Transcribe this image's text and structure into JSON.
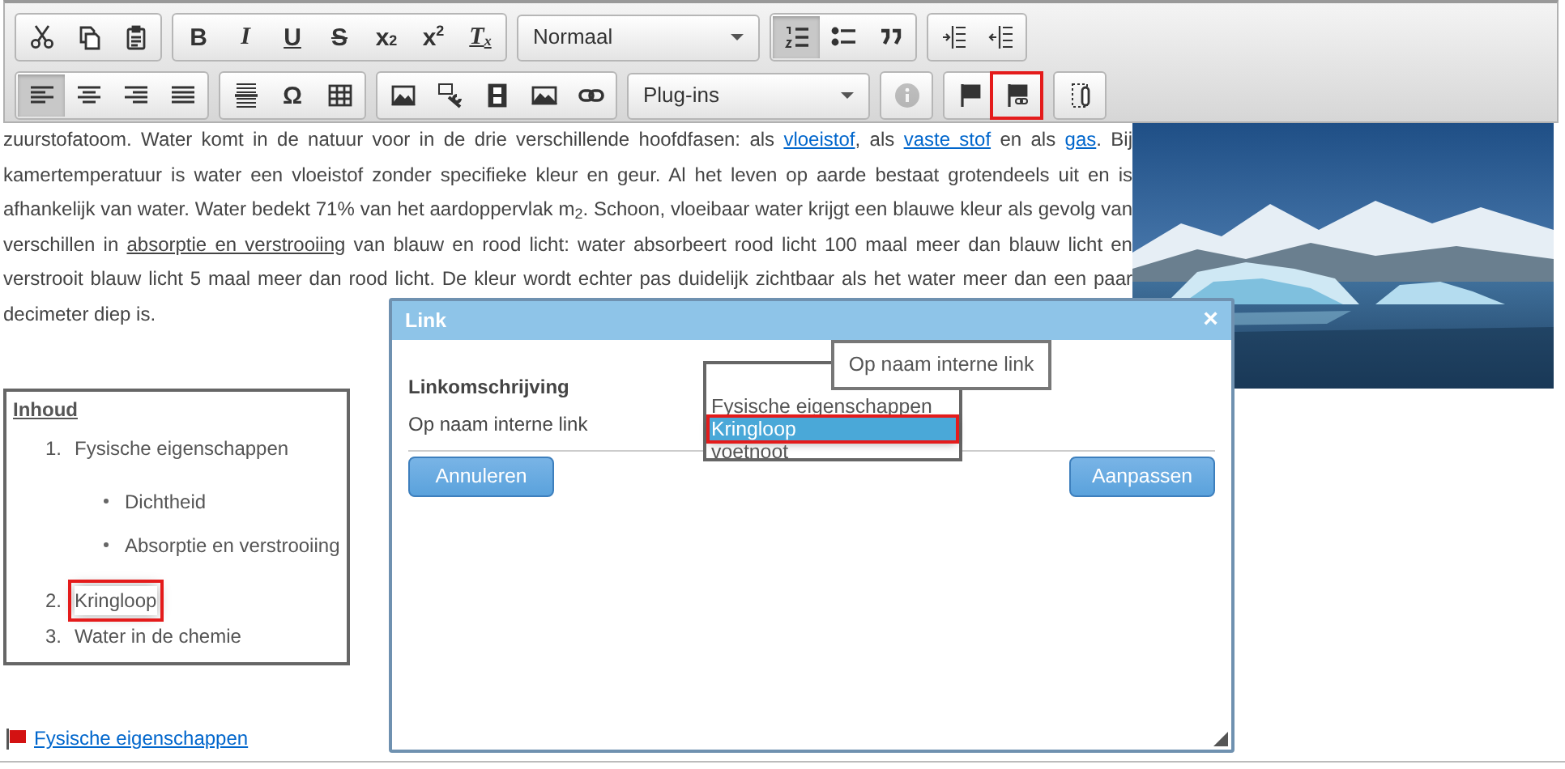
{
  "toolbar": {
    "rows": [
      [
        {
          "buttons": [
            {
              "kind": "icon",
              "selected": false
            },
            {
              "kind": "icon",
              "selected": false
            },
            {
              "kind": "icon",
              "selected": false
            }
          ]
        },
        {
          "buttons": [
            {
              "kind": "glyph",
              "label": "B",
              "selected": false
            },
            {
              "kind": "glyph",
              "label": "I",
              "selected": false
            },
            {
              "kind": "glyph",
              "label": "U",
              "selected": false
            },
            {
              "kind": "glyph",
              "label": "S",
              "selected": false
            },
            {
              "kind": "glyph",
              "label": "x$_{2}$",
              "selected": false
            },
            {
              "kind": "glyph",
              "label": "x$^{2}$",
              "selected": false
            },
            {
              "kind": "glyph",
              "label": "T$_{x}$",
              "selected": false
            }
          ]
        },
        {
          "dropdown": "Normaal"
        },
        {
          "buttons": [
            {
              "kind": "icon",
              "selected": true
            },
            {
              "kind": "icon",
              "selected": false
            },
            {
              "kind": "icon",
              "selected": false
            }
          ]
        },
        {
          "buttons": [
            {
              "kind": "icon",
              "selected": false
            },
            {
              "kind": "icon",
              "selected": false
            }
          ]
        }
      ],
      [
        {
          "buttons": [
            {
              "kind": "icon",
              "selected": true
            },
            {
              "kind": "icon",
              "selected": false
            },
            {
              "kind": "icon",
              "selected": false
            },
            {
              "kind": "icon",
              "selected": false
            }
          ]
        },
        {
          "buttons": [
            {
              "kind": "icon",
              "selected": false
            },
            {
              "kind": "glyph",
              "label": "Ω",
              "selected": false
            },
            {
              "kind": "icon",
              "selected": false
            }
          ]
        },
        {
          "buttons": [
            {
              "kind": "icon",
              "selected": false
            },
            {
              "kind": "icon",
              "selected": false
            },
            {
              "kind": "icon",
              "selected": false
            },
            {
              "kind": "icon",
              "selected": false
            },
            {
              "kind": "icon",
              "selected": false
            }
          ]
        },
        {
          "dropdown": "Plug-ins"
        },
        {
          "buttons": [
            {
              "kind": "icon",
              "selected": false,
              "disabled": true
            }
          ]
        },
        {
          "buttons": [
            {
              "kind": "icon",
              "selected": false
            },
            {
              "kind": "icon",
              "selected": false,
              "highlighted": true
            }
          ]
        },
        {
          "buttons": [
            {
              "kind": "icon",
              "selected": false
            }
          ]
        }
      ]
    ]
  },
  "paragraph": [
    {
      "kind": "text",
      "text": "zuurstofatoom. Water komt in de natuur voor in de drie verschillende hoofdfasen: als "
    },
    {
      "kind": "link",
      "text": "vloeistof"
    },
    {
      "kind": "text",
      "text": ", als "
    },
    {
      "kind": "link",
      "text": "vaste stof"
    },
    {
      "kind": "text",
      "text": " en als "
    },
    {
      "kind": "link",
      "text": "gas"
    },
    {
      "kind": "text",
      "text": ". Bij kamertemperatuur is water een vloeistof zonder specifieke kleur en geur. Al het leven op aarde bestaat grotendeels uit en is afhankelijk van water. Water bedekt 71% van het aardoppervlak m$_{2}$. Schoon, vloeibaar water krijgt een blauwe kleur als gevolg van verschillen in "
    },
    {
      "kind": "anchor",
      "text": "absorptie en verstrooiing"
    },
    {
      "kind": "text",
      "text": " van blauw en rood licht: water absorbeert rood licht 100 maal meer dan blauw licht en verstrooit blauw licht 5 maal meer dan rood licht. De kleur wordt echter pas duidelijk zichtbaar als het water meer dan een paar decimeter diep is."
    }
  ],
  "toc": {
    "title": "Inhoud",
    "items": [
      {
        "number": "1.",
        "text": "Fysische eigenschappen",
        "highlighted": false,
        "children": [
          {
            "text": "Dichtheid"
          },
          {
            "text": "Absorptie en verstrooiing"
          }
        ]
      },
      {
        "number": "2.",
        "text": "Kringloop",
        "highlighted": true
      },
      {
        "number": "3.",
        "text": "Water in de chemie",
        "highlighted": false
      }
    ]
  },
  "anchor_link": {
    "text": "Fysische eigenschappen"
  },
  "dialog": {
    "title": "Link",
    "close": "×",
    "description_label": "Linkomschrijving",
    "anchor_label": "Op naam interne link",
    "tooltip": "Op naam interne link",
    "options": [
      {
        "text": "Fysische eigenschappen",
        "selected": false,
        "highlighted": false
      },
      {
        "text": "Kringloop",
        "selected": true,
        "highlighted": true
      },
      {
        "text": "voetnoot",
        "selected": false,
        "highlighted": false
      }
    ],
    "buttons": [
      "Annuleren",
      "Aanpassen"
    ]
  }
}
